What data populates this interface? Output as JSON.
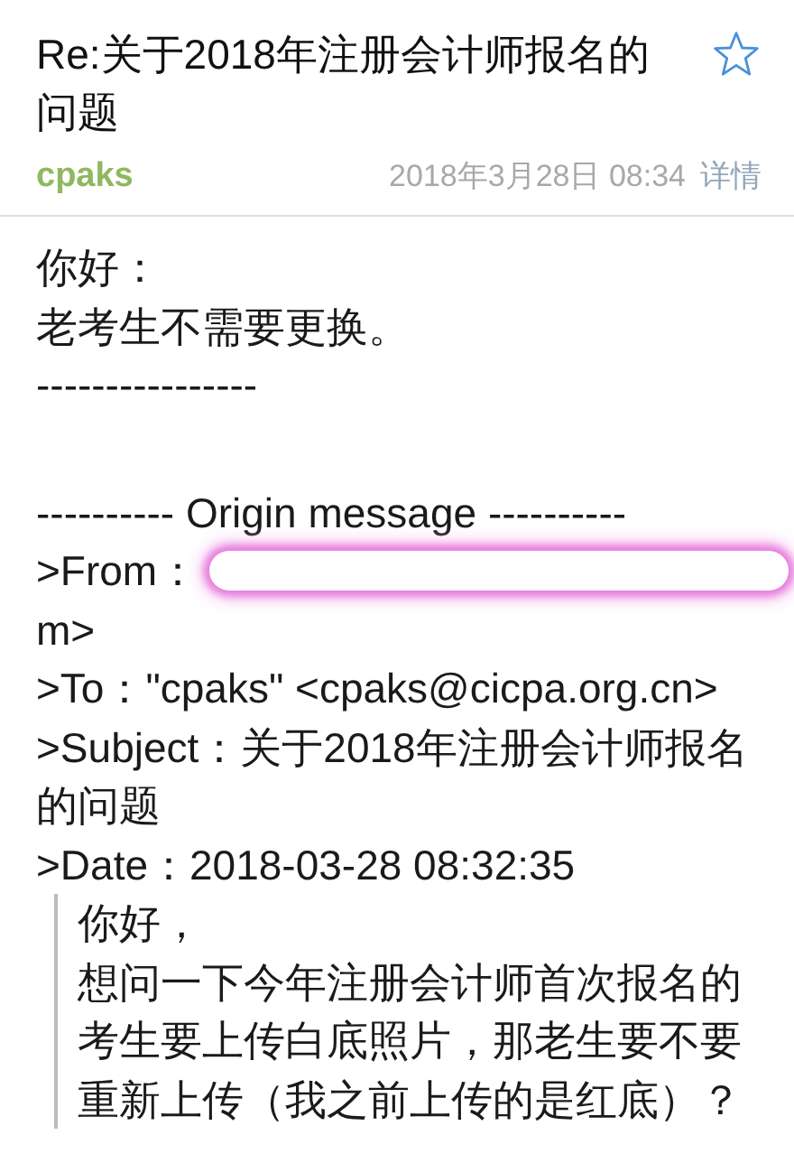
{
  "header": {
    "subject": "Re:关于2018年注册会计师报名的问题",
    "starred": false,
    "sender": "cpaks",
    "date": "2018年3月28日 08:34",
    "details_link": "详情"
  },
  "body": {
    "lines": [
      "你好：",
      "老考生不需要更换。",
      "----------------"
    ],
    "original": {
      "separator": "---------- Origin message ----------",
      "from_label": ">From：",
      "from_redacted": true,
      "from_tail": "m>",
      "to": ">To：\"cpaks\" <cpaks@cicpa.org.cn>",
      "subject": ">Subject：关于2018年注册会计师报名的问题",
      "date": ">Date：2018-03-28 08:32:35"
    },
    "quote": [
      "你好，",
      "想问一下今年注册会计师首次报名的考生要上传白底照片，那老生要不要重新上传（我之前上传的是红底）？"
    ]
  }
}
